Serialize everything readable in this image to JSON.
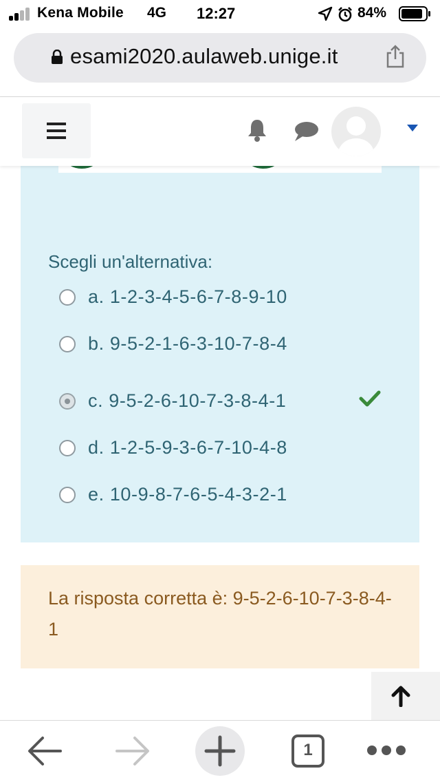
{
  "status_bar": {
    "carrier": "Kena Mobile",
    "network": "4G",
    "time": "12:27",
    "battery": "84%",
    "icons": [
      "signal-icon",
      "location-icon",
      "alarm-icon",
      "battery-icon"
    ]
  },
  "browser": {
    "url": "esami2020.aulaweb.unige.it",
    "open_tabs": "1",
    "icons": [
      "lock-icon",
      "share-icon",
      "back-icon",
      "forward-icon",
      "plus-icon",
      "more-icon"
    ]
  },
  "navbar": {
    "icons": [
      "hamburger-icon",
      "bell-icon",
      "chat-icon",
      "avatar",
      "caret-down-icon"
    ]
  },
  "question": {
    "prompt": "Scegli un'alternativa:",
    "options": [
      {
        "label": "a. 1-2-3-4-5-6-7-8-9-10",
        "selected": false
      },
      {
        "label": "b. 9-5-2-1-6-3-10-7-8-4",
        "selected": false
      },
      {
        "label": "c. 9-5-2-6-10-7-3-8-4-1",
        "selected": true,
        "correct": true
      },
      {
        "label": "d. 1-2-5-9-3-6-7-10-4-8",
        "selected": false
      },
      {
        "label": "e. 10-9-8-7-6-5-4-3-2-1",
        "selected": false
      }
    ]
  },
  "feedback": {
    "right_answer": "La risposta corretta è: 9-5-2-6-10-7-3-8-4-1"
  },
  "colors": {
    "question_bg": "#def2f8",
    "question_text": "#2f6473",
    "answer_bg": "#fcefdc",
    "answer_text": "#8a5a20",
    "check": "#3a8a3a",
    "caret": "#1a56b3"
  }
}
